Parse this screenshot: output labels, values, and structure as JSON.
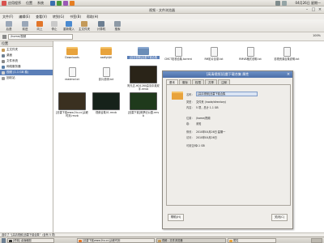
{
  "top_panel": {
    "apps_label": "应用程序",
    "places_label": "位置",
    "system_label": "系统",
    "clock": "04月26日 星期一"
  },
  "window": {
    "title": "视频 - 文件浏览器"
  },
  "menu": [
    "文件(F)",
    "编辑(E)",
    "查看(V)",
    "转到(G)",
    "书签(B)",
    "帮助(H)"
  ],
  "toolbar": {
    "back": "后退",
    "forward": "前进",
    "up": "向上",
    "stop": "停止",
    "reload": "重新载入",
    "home": "主文件夹",
    "computer": "计算机",
    "search": "搜索"
  },
  "location": {
    "path": "/home/视频",
    "zoom": "100%"
  },
  "sidebar": {
    "header": "位置",
    "items": [
      {
        "label": "主文件夹",
        "selected": false
      },
      {
        "label": "桌面",
        "selected": false
      },
      {
        "label": "文件系统",
        "selected": false
      },
      {
        "label": "网络服务器",
        "selected": false
      },
      {
        "label": "视频 (1.1 GB 卷)",
        "selected": true
      },
      {
        "label": "回收站",
        "selected": false
      }
    ]
  },
  "files": [
    {
      "name": "Downloads",
      "kind": "folder"
    },
    {
      "name": "asdfghjkl",
      "kind": "folder"
    },
    {
      "name": "[高清视频]迅雷下载合集",
      "kind": "folder",
      "selected": true
    },
    {
      "name": "CMCT影视合集.torrent",
      "kind": "doc"
    },
    {
      "name": "RM影片目录.txt",
      "kind": "doc"
    },
    {
      "name": "RMVB格式说明.txt",
      "kind": "doc"
    },
    {
      "name": "影视资源合集说明.txt",
      "kind": "doc"
    },
    {
      "name": "readme.txt",
      "kind": "doc"
    },
    {
      "name": "影片说明.txt",
      "kind": "doc"
    },
    {
      "name": "[迅雷下载www.2tu.cc]尖峰时刻.rmvb",
      "kind": "video"
    },
    {
      "name": "视频合集01.rmvb",
      "kind": "video"
    },
    {
      "name": "[迅雷下载]侏罗纪公园.rmvb",
      "kind": "video"
    },
    {
      "name": "阿凡达.HD1280高清中英双字.rmvb",
      "kind": "video"
    }
  ],
  "dialog": {
    "title": "[高清视频]迅雷下载合集 属性",
    "tabs": [
      "基本",
      "徽标",
      "权限",
      "共享",
      "注释"
    ],
    "name_value": "[高清视频]迅雷下载合集",
    "rows": [
      {
        "key": "名称：",
        "value": ""
      },
      {
        "key": "类型：",
        "value": "文件夹 (inode/directory)"
      },
      {
        "key": "内容：",
        "value": "5 项，总计 1.1 GB"
      },
      {
        "key": "位置：",
        "value": "/home/视频"
      },
      {
        "key": "卷：",
        "value": "未知"
      },
      {
        "key": "修改：",
        "value": "2010年04月26日 星期一"
      },
      {
        "key": "访问：",
        "value": "2010年04月26日"
      },
      {
        "key": "可用空间：",
        "value": "2.1 GB"
      }
    ],
    "help_button": "帮助(H)",
    "close_button": "关闭(C)"
  },
  "statusbar": {
    "text": "选中了 “[高清视频]迅雷下载合集”（含有 5 项）"
  },
  "taskbar": [
    {
      "label": "[终端] 桌面截图",
      "active": false
    },
    {
      "label": "[迅雷下载www.2tu.cc]尖峰时刻",
      "active": false
    },
    {
      "label": "视频 - 文件浏览器",
      "active": true
    },
    {
      "label": "属性",
      "active": false
    }
  ],
  "colors": {
    "selection": "#5b7fb8",
    "folder": "#e8a33c",
    "dialog_title": "#4b6fa8"
  }
}
